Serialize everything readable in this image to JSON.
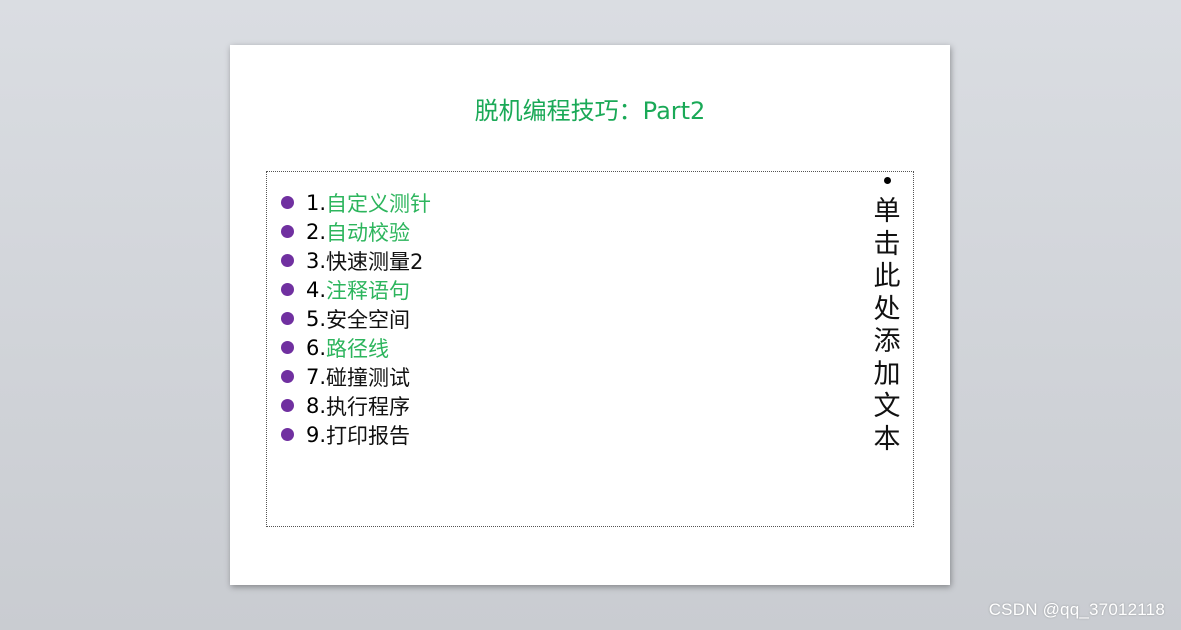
{
  "slide": {
    "title": "脱机编程技巧：Part2",
    "items": [
      {
        "num": "1.",
        "text": "自定义测针",
        "color": "green"
      },
      {
        "num": "2.",
        "text": "自动校验",
        "color": "green"
      },
      {
        "num": "3.",
        "text": "快速测量2",
        "color": "black"
      },
      {
        "num": "4.",
        "text": "注释语句",
        "color": "green"
      },
      {
        "num": "5.",
        "text": "安全空间",
        "color": "black"
      },
      {
        "num": "6.",
        "text": "路径线",
        "color": "green"
      },
      {
        "num": "7.",
        "text": "碰撞测试",
        "color": "black"
      },
      {
        "num": "8.",
        "text": "执行程序",
        "color": "black"
      },
      {
        "num": "9.",
        "text": "打印报告",
        "color": "black"
      }
    ],
    "placeholder_text": "单击此处添加文本"
  },
  "colors": {
    "title": "#1aa957",
    "bullet": "#7030a0",
    "highlight": "#2db55d"
  },
  "watermark": "CSDN @qq_37012118"
}
